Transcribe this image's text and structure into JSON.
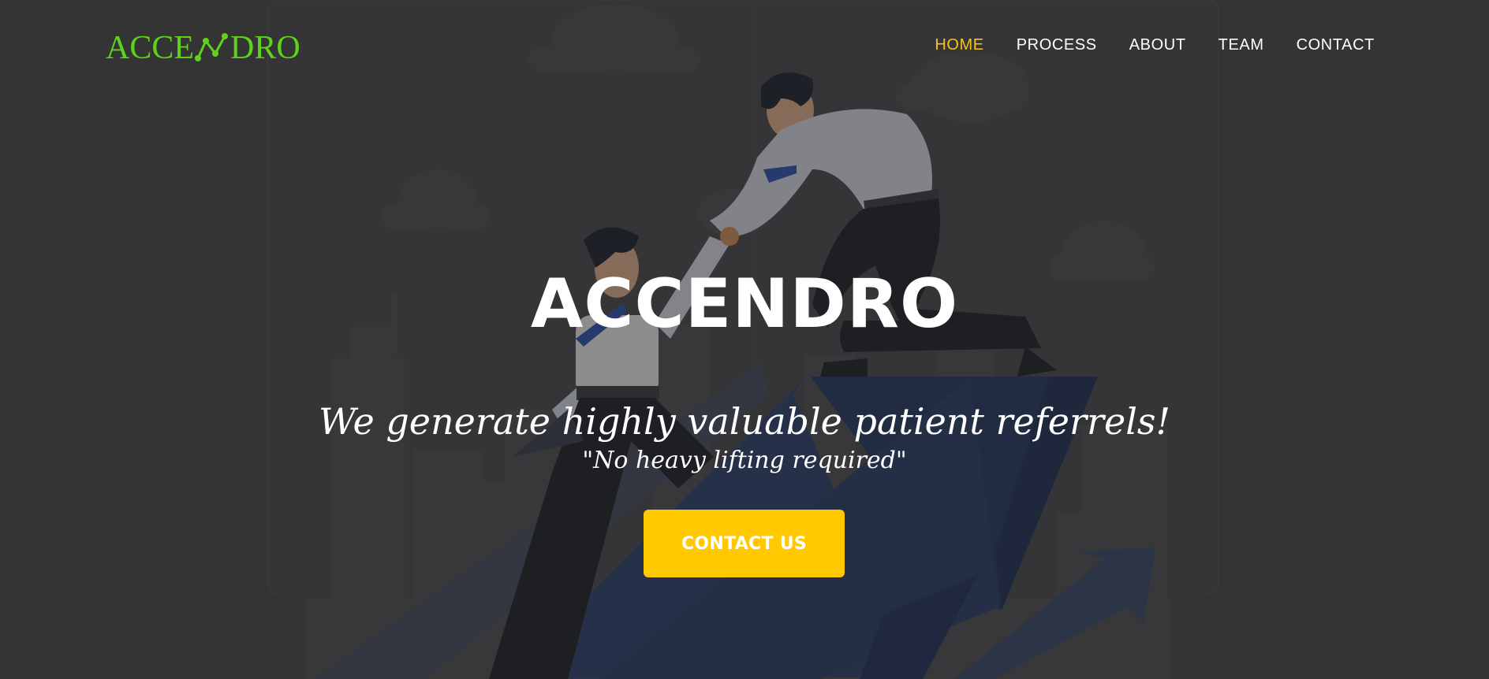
{
  "brand": {
    "logo_left": "ACCE",
    "logo_icon": "line-chart-icon",
    "logo_right": "DRO",
    "logo_color": "#5fd31b"
  },
  "nav": {
    "items": [
      {
        "label": "HOME",
        "active": true
      },
      {
        "label": "PROCESS",
        "active": false
      },
      {
        "label": "ABOUT",
        "active": false
      },
      {
        "label": "TEAM",
        "active": false
      },
      {
        "label": "CONTACT",
        "active": false
      }
    ],
    "active_color": "#f5c417",
    "color": "#ffffff"
  },
  "hero": {
    "title": "ACCENDRO",
    "subtitle": "We generate highly valuable patient referrels!",
    "quote": "\"No heavy lifting required\"",
    "cta_label": "CONTACT US",
    "cta_color": "#ffc800",
    "illustration": "businessmen-climbing-arrow-illustration"
  }
}
